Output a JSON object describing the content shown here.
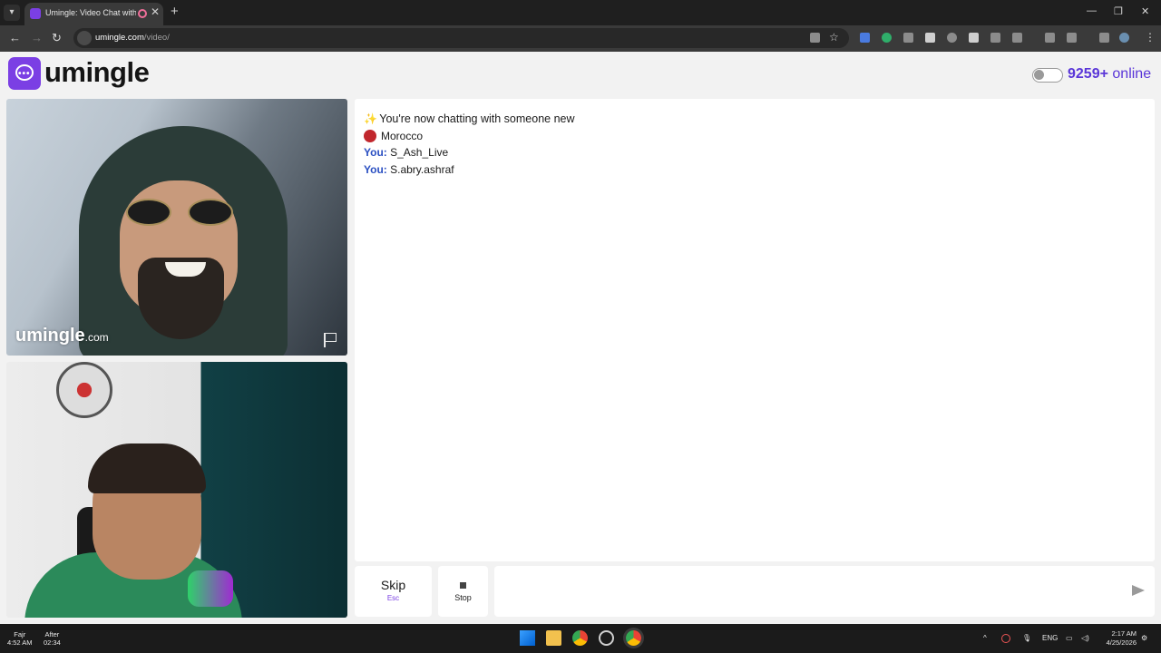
{
  "browser": {
    "tab_title": "Umingle: Video Chat with S",
    "tab_close": "✕",
    "new_tab": "+",
    "url_host": "umingle.com",
    "url_path": "/video/",
    "window_controls": [
      "—",
      "❐",
      "✕"
    ]
  },
  "header": {
    "logo_text": "umingle",
    "online_count": "9259+",
    "online_label": "online"
  },
  "video": {
    "watermark_brand": "umingle",
    "watermark_tld": ".com"
  },
  "chat": {
    "system_message": "You're now chatting with someone new",
    "country": "Morocco",
    "messages": [
      {
        "sender": "You:",
        "text": "S_Ash_Live"
      },
      {
        "sender": "You:",
        "text": "S.abry.ashraf"
      }
    ]
  },
  "controls": {
    "skip_label": "Skip",
    "skip_hint": "Esc",
    "stop_label": "Stop",
    "message_value": ""
  },
  "taskbar": {
    "prayer_1_name": "Fajr",
    "prayer_1_time": "4:52 AM",
    "prayer_2_name": "After",
    "prayer_2_time": "02:34",
    "language": "ENG",
    "time": "2:17 AM",
    "date": "4/25/2026"
  },
  "colors": {
    "brand": "#7b3fe4",
    "online_text": "#5a36d8",
    "you_label": "#2a4fc2",
    "flag": "#c1272d"
  }
}
